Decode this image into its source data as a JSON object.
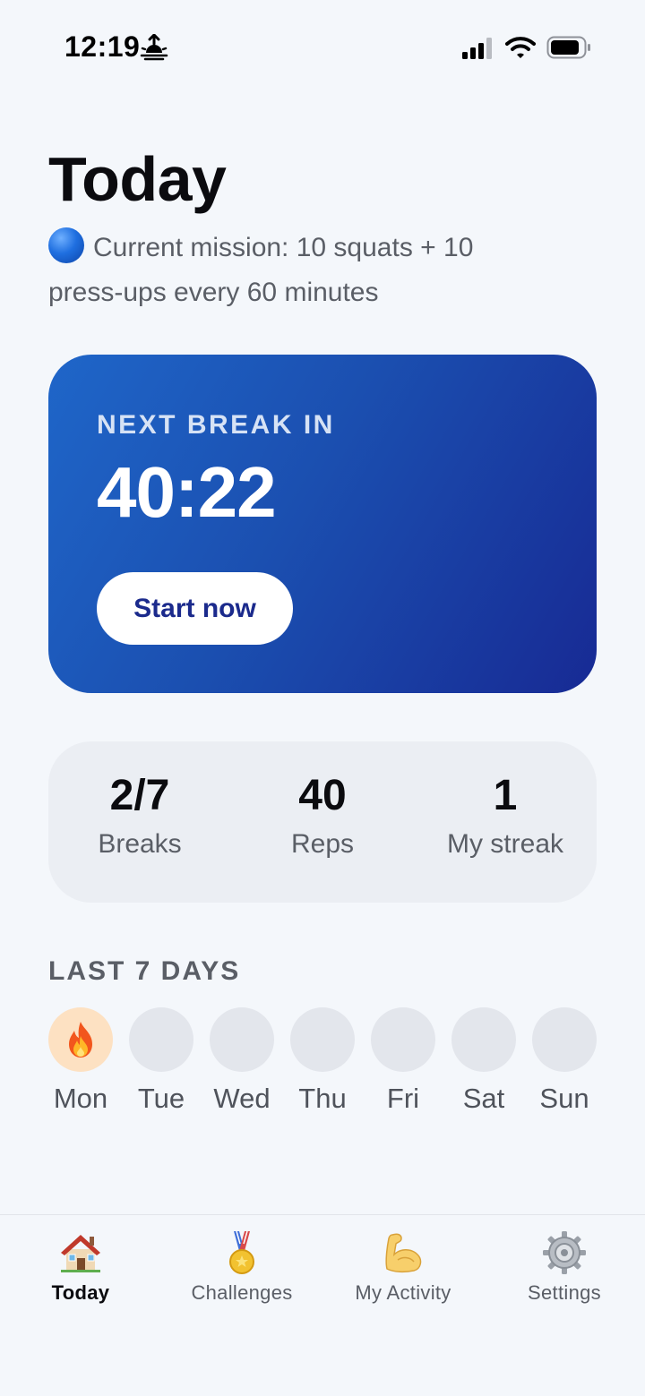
{
  "status_bar": {
    "time": "12:19"
  },
  "header": {
    "title": "Today",
    "mission": "Current mission: 10 squats + 10 press-ups every 60 minutes"
  },
  "timer": {
    "label": "NEXT BREAK IN",
    "value": "40:22",
    "button_label": "Start now"
  },
  "stats": [
    {
      "value": "2/7",
      "label": "Breaks"
    },
    {
      "value": "40",
      "label": "Reps"
    },
    {
      "value": "1",
      "label": "My streak"
    }
  ],
  "last_days": {
    "title": "LAST 7 DAYS",
    "days": [
      {
        "label": "Mon",
        "active": true,
        "icon": "fire-icon"
      },
      {
        "label": "Tue",
        "active": false
      },
      {
        "label": "Wed",
        "active": false
      },
      {
        "label": "Thu",
        "active": false
      },
      {
        "label": "Fri",
        "active": false
      },
      {
        "label": "Sat",
        "active": false
      },
      {
        "label": "Sun",
        "active": false
      }
    ]
  },
  "tab_bar": {
    "tabs": [
      {
        "label": "Today",
        "icon": "house-icon",
        "active": true
      },
      {
        "label": "Challenges",
        "icon": "medal-icon",
        "active": false
      },
      {
        "label": "My Activity",
        "icon": "flexed-biceps-icon",
        "active": false
      },
      {
        "label": "Settings",
        "icon": "gear-icon",
        "active": false
      }
    ]
  },
  "colors": {
    "background": "#f4f7fb",
    "card_gradient_start": "#1f66c9",
    "card_gradient_end": "#172a94",
    "button_text": "#1b2a8c",
    "stats_background": "#ebeef3",
    "active_day": "#fde1c2",
    "inactive_day": "#e3e6ec"
  }
}
